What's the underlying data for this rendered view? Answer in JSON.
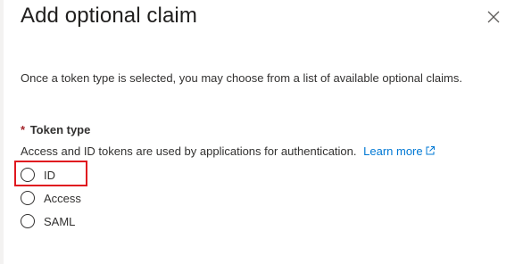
{
  "dialog": {
    "title": "Add optional claim",
    "close_icon": "close-icon"
  },
  "intro_text": "Once a token type is selected, you may choose from a list of available optional claims.",
  "token_type": {
    "required_marker": "*",
    "label": "Token type",
    "description": "Access and ID tokens are used by applications for authentication.",
    "learn_more": "Learn more",
    "learn_more_icon": "external-link-icon",
    "options": [
      {
        "label": "ID",
        "selected": false,
        "highlighted": true
      },
      {
        "label": "Access",
        "selected": false
      },
      {
        "label": "SAML",
        "selected": false
      }
    ]
  },
  "colors": {
    "link": "#0078d4",
    "required": "#a4262c",
    "highlight": "#e0171f",
    "text": "#323130"
  }
}
